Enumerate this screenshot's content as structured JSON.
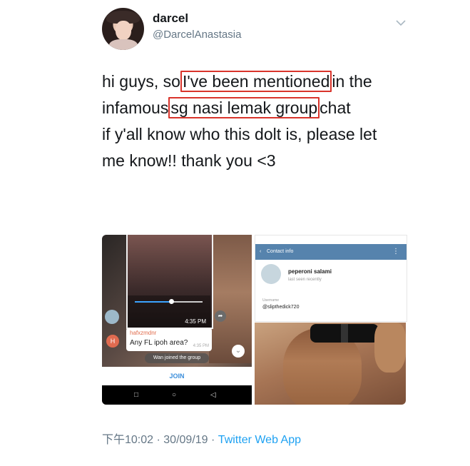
{
  "user": {
    "display_name": "darcel",
    "handle": "@DarcelAnastasia"
  },
  "tweet": {
    "line1_a": "hi guys, so",
    "line1_hl": "I've been mentioned",
    "line1_b": "in the",
    "line2_a": "infamous",
    "line2_hl": "sg nasi lemak group",
    "line2_b": "chat",
    "line3": "if y'all know who this dolt is, please let",
    "line4": "me know!! thank you <3"
  },
  "media": {
    "chat": {
      "video_time": "4:35 PM",
      "sender": "hafxzmdnr",
      "message": "Any FL ipoh area?",
      "message_time": "4:35 PM",
      "sender_initial": "H",
      "joined_notice": "Wan joined the group",
      "join_label": "JOIN"
    },
    "contact": {
      "header": "Contact info",
      "name": "peperoni salami",
      "status": "last seen recently",
      "username_label": "Username",
      "username": "@slipthedick720"
    }
  },
  "footer": {
    "time": "下午10:02",
    "date": "30/09/19",
    "separator": "·",
    "source": "Twitter Web App"
  },
  "icons": [
    "chevron-down-icon",
    "back-arrow-icon",
    "more-vert-icon",
    "share-icon",
    "scroll-down-icon"
  ],
  "colors": {
    "highlight_border": "#d9342b",
    "link": "#1da1f2",
    "secondary_text": "#657786",
    "contact_header": "#5683ad"
  }
}
